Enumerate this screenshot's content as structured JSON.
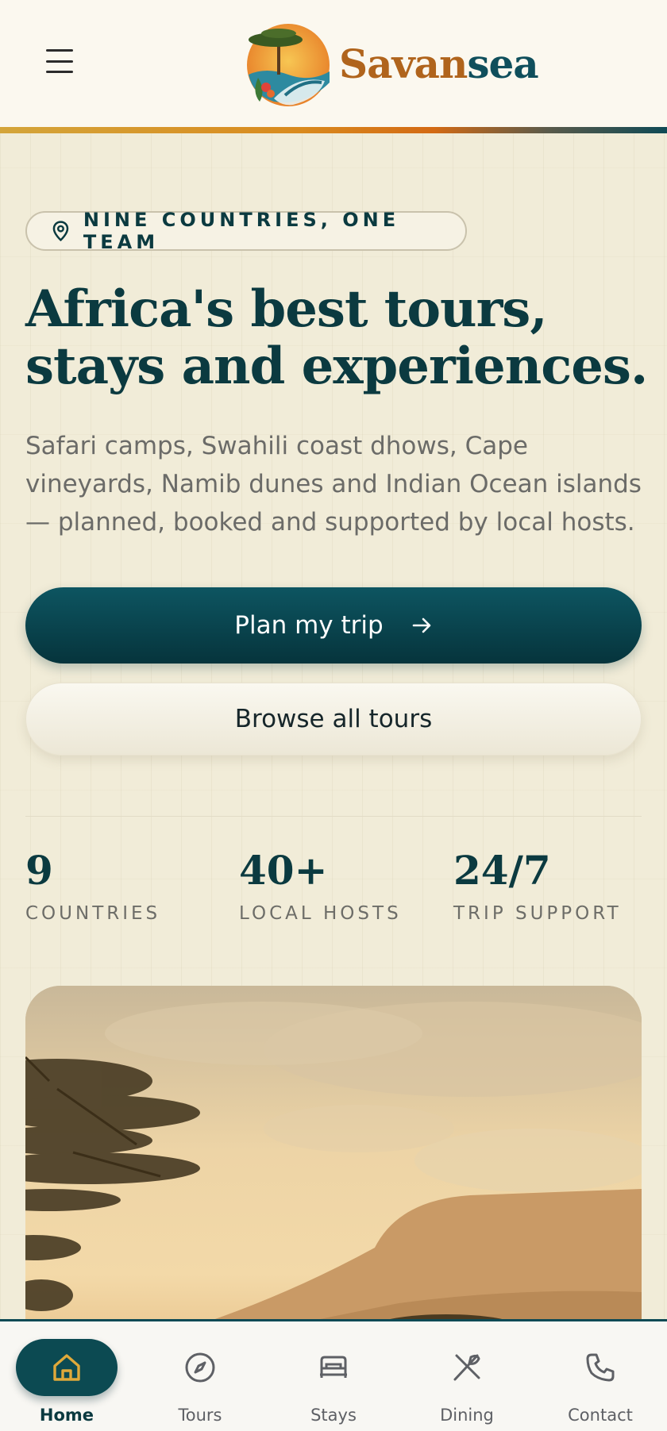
{
  "header": {
    "brand_part1": "Savan",
    "brand_part2": "sea",
    "menu_icon": "hamburger-menu-icon"
  },
  "hero": {
    "pill_icon": "map-pin-icon",
    "pill_text": "NINE COUNTRIES, ONE TEAM",
    "headline_line1": "Africa's best tours,",
    "headline_line2": "stays and experiences.",
    "subtext": "Safari camps, Swahili coast dhows, Cape vineyards, Namib dunes and Indian Ocean islands — planned, booked and supported by local hosts.",
    "primary_button": "Plan my trip",
    "primary_button_icon": "arrow-right-icon",
    "secondary_button": "Browse all tours"
  },
  "stats": [
    {
      "value": "9",
      "label": "COUNTRIES"
    },
    {
      "value": "40+",
      "label": "LOCAL HOSTS"
    },
    {
      "value": "24/7",
      "label": "TRIP SUPPORT"
    }
  ],
  "bottom_nav": [
    {
      "label": "Home",
      "icon": "home-icon",
      "active": true
    },
    {
      "label": "Tours",
      "icon": "compass-icon",
      "active": false
    },
    {
      "label": "Stays",
      "icon": "bed-icon",
      "active": false
    },
    {
      "label": "Dining",
      "icon": "utensils-icon",
      "active": false
    },
    {
      "label": "Contact",
      "icon": "phone-icon",
      "active": false
    }
  ],
  "colors": {
    "brand_dark": "#0b3a40",
    "brand_accent": "#b0641c",
    "background": "#f1ecd8",
    "nav_active_icon": "#e0a93a"
  }
}
